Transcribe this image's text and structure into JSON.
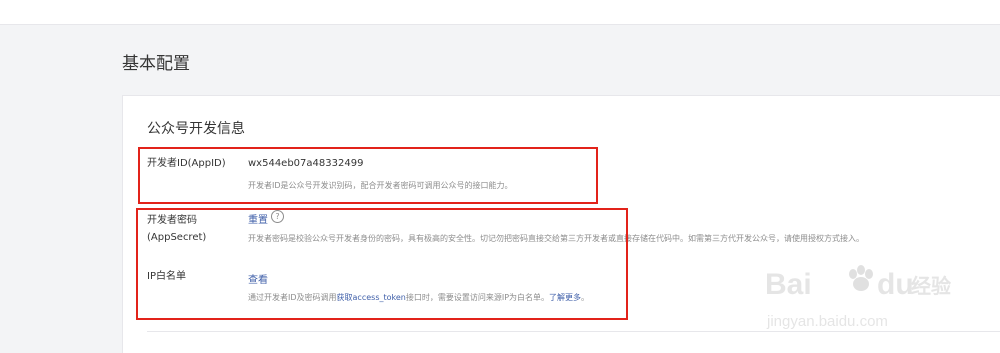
{
  "page": {
    "title": "基本配置"
  },
  "section": {
    "title": "公众号开发信息"
  },
  "fields": {
    "app_id": {
      "label": "开发者ID(AppID)",
      "value": "wx544eb07a48332499",
      "desc": "开发者ID是公众号开发识别码，配合开发者密码可调用公众号的接口能力。"
    },
    "app_secret": {
      "label_line1": "开发者密码",
      "label_line2": "(AppSecret)",
      "action": "重置",
      "help_icon": "?",
      "desc": "开发者密码是校验公众号开发者身份的密码，具有极高的安全性。切记勿把密码直接交给第三方开发者或直接存储在代码中。如需第三方代开发公众号，请使用授权方式接入。"
    },
    "ip_whitelist": {
      "label": "IP白名单",
      "action": "查看",
      "desc_prefix": "通过开发者ID及密码调用",
      "desc_link": "获取access_token",
      "desc_middle": "接口时，需要设置访问来源IP为白名单。",
      "desc_learn_more": "了解更多",
      "desc_end": "。"
    }
  },
  "watermark": {
    "main": "Bai",
    "du": "du",
    "cn": "经验",
    "url": "jingyan.baidu.com"
  },
  "colors": {
    "accent_link": "#3f5fa9",
    "highlight": "#e2231a",
    "background": "#f3f4f6"
  }
}
